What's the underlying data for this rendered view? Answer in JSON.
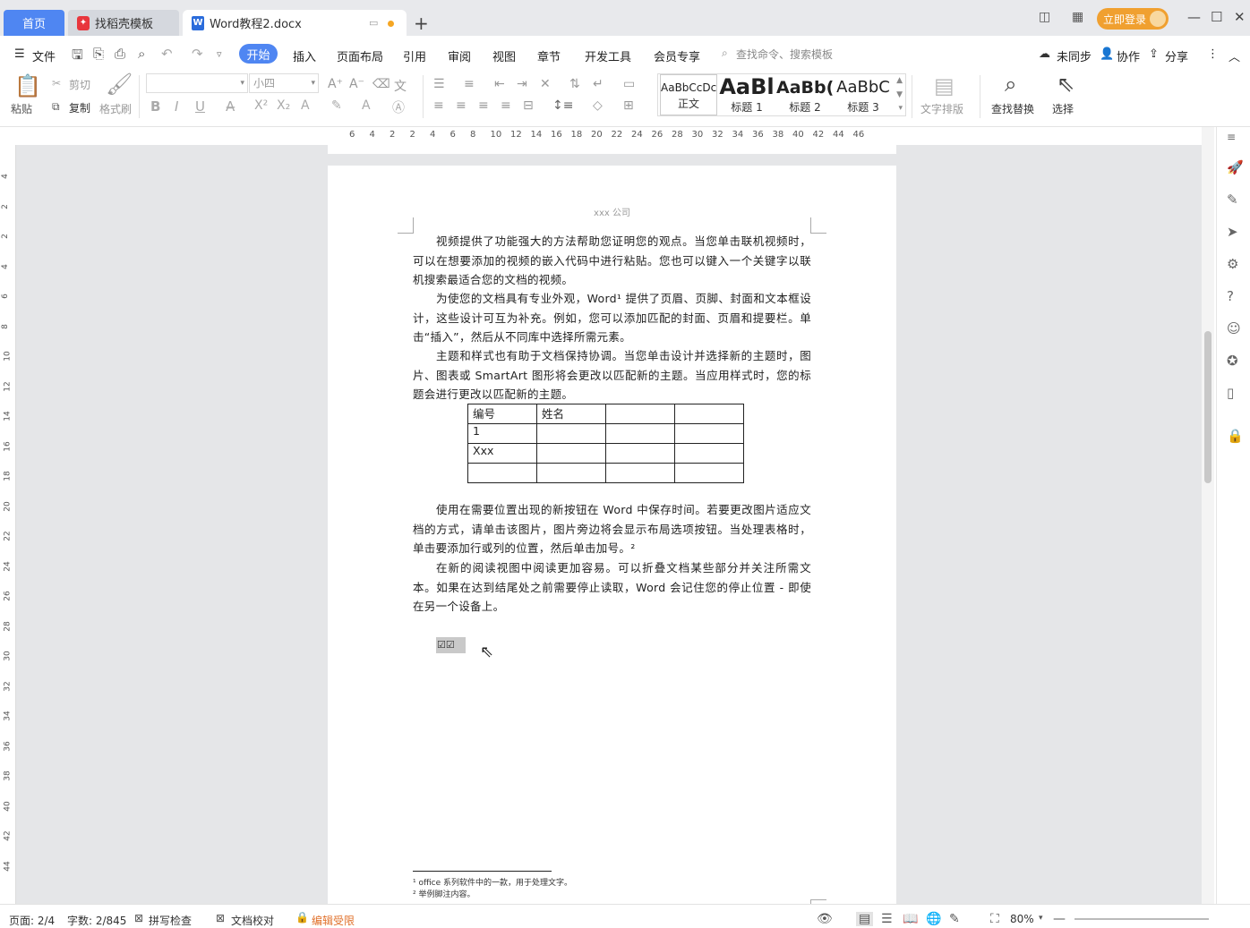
{
  "titlebar": {
    "tabs": [
      {
        "label": "首页"
      },
      {
        "label": "找稻壳模板"
      },
      {
        "label": "Word教程2.docx"
      }
    ],
    "new_tab": "+",
    "login_label": "立即登录"
  },
  "menubar": {
    "file_label": "文件",
    "items": [
      "开始",
      "插入",
      "页面布局",
      "引用",
      "审阅",
      "视图",
      "章节",
      "开发工具",
      "会员专享"
    ],
    "search_placeholder": "查找命令、搜索模板",
    "sync_label": "未同步",
    "collab_label": "协作",
    "share_label": "分享"
  },
  "ribbon": {
    "paste": "粘贴",
    "cut": "剪切",
    "copy": "复制",
    "format_painter": "格式刷",
    "font_name": "",
    "font_size": "小四",
    "styles": [
      {
        "preview": "AaBbCcDc",
        "label": "正文"
      },
      {
        "preview": "AaBl",
        "label": "标题 1"
      },
      {
        "preview": "AaBb(",
        "label": "标题 2"
      },
      {
        "preview": "AaBbC",
        "label": "标题 3"
      }
    ],
    "text_layout": "文字排版",
    "find_replace": "查找替换",
    "select": "选择"
  },
  "ruler": {
    "ticks": [
      "6",
      "4",
      "2",
      "2",
      "4",
      "6",
      "8",
      "10",
      "12",
      "14",
      "16",
      "18",
      "20",
      "22",
      "24",
      "26",
      "28",
      "30",
      "32",
      "34",
      "36",
      "38",
      "40",
      "42",
      "44",
      "46"
    ],
    "vticks": [
      "4",
      "2",
      "2",
      "4",
      "6",
      "8",
      "10",
      "12",
      "14",
      "16",
      "18",
      "20",
      "22",
      "24",
      "26",
      "28",
      "30",
      "32",
      "34",
      "36",
      "38",
      "40",
      "42",
      "44"
    ]
  },
  "document": {
    "header": "xxx 公司",
    "paragraphs": [
      "视频提供了功能强大的方法帮助您证明您的观点。当您单击联机视频时，可以在想要添加的视频的嵌入代码中进行粘贴。您也可以键入一个关键字以联机搜索最适合您的文档的视频。",
      "为使您的文档具有专业外观，Word¹ 提供了页眉、页脚、封面和文本框设计，这些设计可互为补充。例如，您可以添加匹配的封面、页眉和提要栏。单击“插入”，然后从不同库中选择所需元素。",
      "主题和样式也有助于文档保持协调。当您单击设计并选择新的主题时，图片、图表或 SmartArt 图形将会更改以匹配新的主题。当应用样式时，您的标题会进行更改以匹配新的主题。",
      "使用在需要位置出现的新按钮在 Word 中保存时间。若要更改图片适应文档的方式，请单击该图片，图片旁边将会显示布局选项按钮。当处理表格时，单击要添加行或列的位置，然后单击加号。²",
      "在新的阅读视图中阅读更加容易。可以折叠文档某些部分并关注所需文本。如果在达到结尾处之前需要停止读取，Word 会记住您的停止位置 - 即使在另一个设备上。"
    ],
    "table": [
      [
        "编号",
        "姓名",
        "",
        ""
      ],
      [
        "1",
        "",
        "",
        ""
      ],
      [
        "Xxx",
        "",
        "",
        ""
      ],
      [
        "",
        "",
        "",
        ""
      ]
    ],
    "checkboxes": "☑☑",
    "footnotes": [
      "¹  office 系列软件中的一款，用于处理文字。",
      "²  举例脚注内容。"
    ]
  },
  "statusbar": {
    "page": "页面: 2/4",
    "words": "字数: 2/845",
    "spell": "拼写检查",
    "proof": "文档校对",
    "restrict": "编辑受限",
    "zoom": "80%"
  }
}
